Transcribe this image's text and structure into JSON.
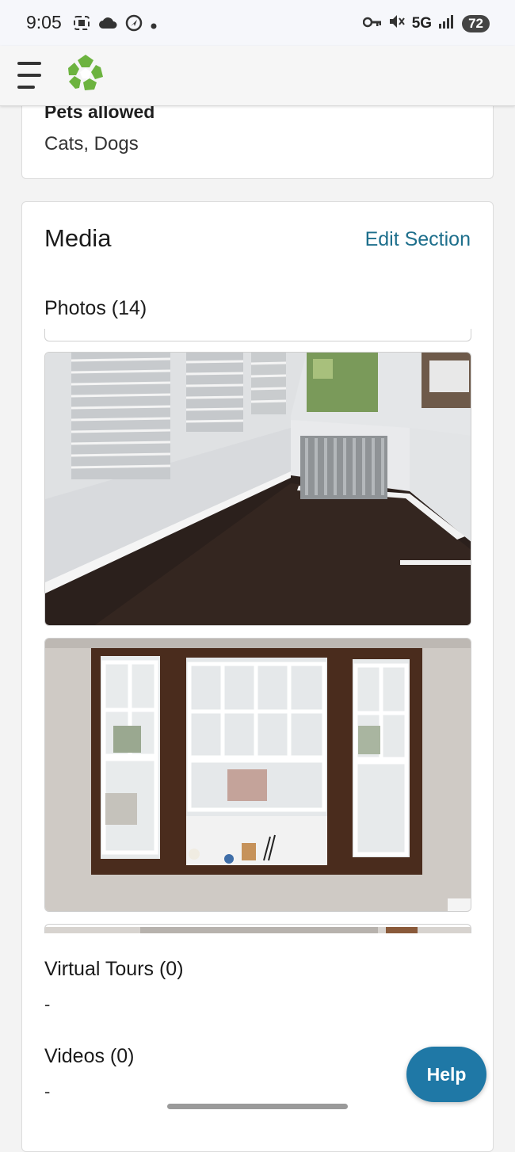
{
  "status_bar": {
    "time": "9:05",
    "network": "5G",
    "battery": "72",
    "left_icons": [
      "screenshot-icon",
      "cloud-icon",
      "navigation-icon",
      "dot-icon"
    ],
    "right_icons": [
      "vpn-key-icon",
      "mute-icon",
      "signal-icon",
      "battery-icon"
    ]
  },
  "top_bar": {
    "menu_icon": "hamburger-menu-icon",
    "logo_icon": "recycle-logo-icon",
    "logo_color": "#6cb33f"
  },
  "pets": {
    "label": "Pets allowed",
    "value": "Cats, Dogs"
  },
  "media": {
    "title": "Media",
    "edit_label": "Edit Section",
    "photos_label": "Photos (14)",
    "virtual_tours_label": "Virtual Tours (0)",
    "virtual_tours_value": "-",
    "videos_label": "Videos (0)",
    "videos_value": "-"
  },
  "help": {
    "label": "Help",
    "color": "#1f78a6"
  },
  "colors": {
    "accent_link": "#1e6f8c",
    "background": "#f3f3f3"
  }
}
